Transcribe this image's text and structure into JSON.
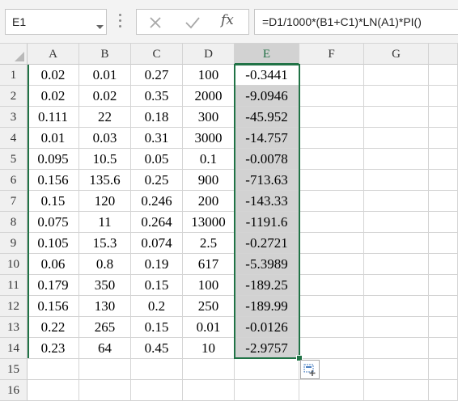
{
  "name_box": {
    "value": "E1",
    "dropdown_icon": "chevron-down-icon"
  },
  "formula_bar": {
    "cancel_icon": "close-icon",
    "enter_icon": "checkmark-icon",
    "fx_label": "fx",
    "formula": "=D1/1000*(B1+C1)*LN(A1)*PI()"
  },
  "grid": {
    "columns": [
      "A",
      "B",
      "C",
      "D",
      "E",
      "F",
      "G"
    ],
    "selected_column": "E",
    "rows": [
      "1",
      "2",
      "3",
      "4",
      "5",
      "6",
      "7",
      "8",
      "9",
      "10",
      "11",
      "12",
      "13",
      "14",
      "15",
      "16"
    ],
    "cells": [
      [
        "0.02",
        "0.01",
        "0.27",
        "100",
        "-0.3441"
      ],
      [
        "0.02",
        "0.02",
        "0.35",
        "2000",
        "-9.0946"
      ],
      [
        "0.111",
        "22",
        "0.18",
        "300",
        "-45.952"
      ],
      [
        "0.01",
        "0.03",
        "0.31",
        "3000",
        "-14.757"
      ],
      [
        "0.095",
        "10.5",
        "0.05",
        "0.1",
        "-0.0078"
      ],
      [
        "0.156",
        "135.6",
        "0.25",
        "900",
        "-713.63"
      ],
      [
        "0.15",
        "120",
        "0.246",
        "200",
        "-143.33"
      ],
      [
        "0.075",
        "11",
        "0.264",
        "13000",
        "-1191.6"
      ],
      [
        "0.105",
        "15.3",
        "0.074",
        "2.5",
        "-0.2721"
      ],
      [
        "0.06",
        "0.8",
        "0.19",
        "617",
        "-5.3989"
      ],
      [
        "0.179",
        "350",
        "0.15",
        "100",
        "-189.25"
      ],
      [
        "0.156",
        "130",
        "0.2",
        "250",
        "-189.99"
      ],
      [
        "0.22",
        "265",
        "0.15",
        "0.01",
        "-0.0126"
      ],
      [
        "0.23",
        "64",
        "0.45",
        "10",
        "-2.9757"
      ]
    ],
    "active_cell": "E1",
    "selection_range": "E1:E14"
  },
  "quick_analysis_icon": "quick-analysis-icon",
  "colors": {
    "accent": "#217346",
    "selection_fill": "#d2d2d2",
    "header_bg": "#f0f0f0"
  }
}
